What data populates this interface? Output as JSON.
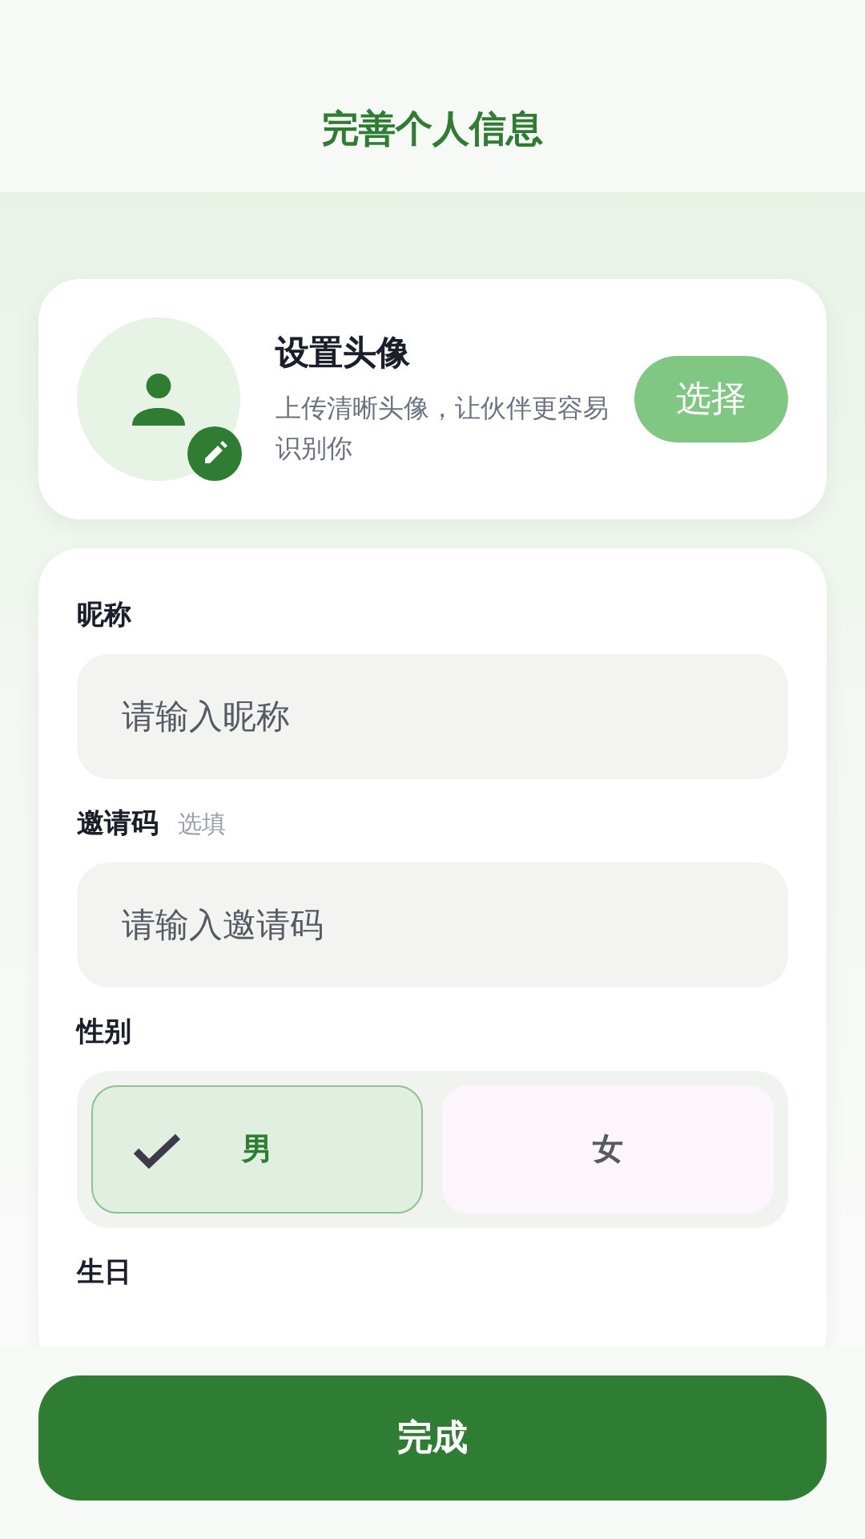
{
  "header": {
    "title": "完善个人信息"
  },
  "avatar_card": {
    "title": "设置头像",
    "description": "上传清晰头像，让伙伴更容易识别你",
    "button": "选择"
  },
  "fields": [
    {
      "label": "昵称",
      "placeholder": "请输入昵称"
    },
    {
      "label": "邀请码",
      "hint": "选填",
      "placeholder": "请输入邀请码"
    }
  ],
  "gender": {
    "label": "性别",
    "options": [
      {
        "label": "男",
        "selected": true
      },
      {
        "label": "女",
        "selected": false
      }
    ]
  },
  "birthday": {
    "label": "生日"
  },
  "submit_button": "完成"
}
